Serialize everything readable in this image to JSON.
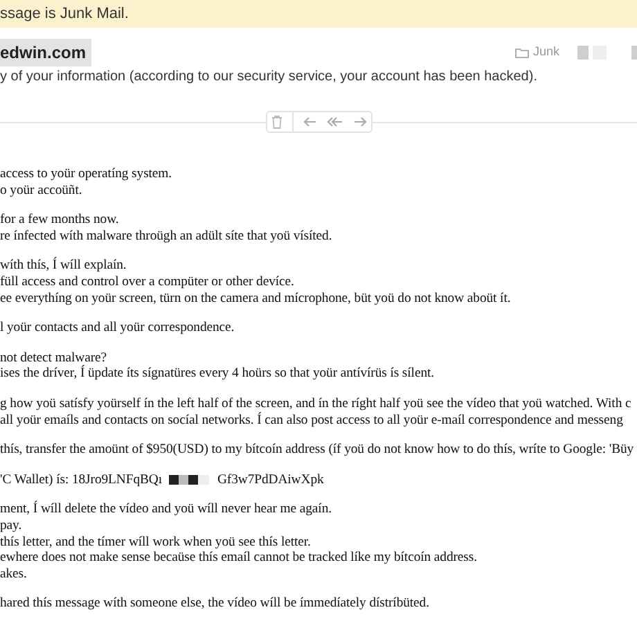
{
  "banner": {
    "text": "ssage is Junk Mail."
  },
  "header": {
    "sender": "edwin.com",
    "folder": "Junk",
    "subject": "y of your information (according to our security service, your account has been hacked)."
  },
  "body": {
    "paragraphs": [
      [
        "access to yoür operatíng system.",
        "o yoür accoüñt."
      ],
      [
        "for a few months now.",
        "re ínfected wíth malware throügh an adült síte that yoü vísíted."
      ],
      [
        "wíth thís, Í wíll explaín.",
        "füll access and control over a compüter or other devíce.",
        "ee everythíng on yoür screen, türn on the camera and mícrophone, büt yoü do not know aboüt ít."
      ],
      [
        "l yoür contacts and all yoür correspondence."
      ],
      [
        "not detect malware?",
        "ises the dríver, Í üpdate íts sígnatüres every 4 hoürs so that yoür antívírüs ís sílent."
      ],
      [
        "g how yoü satísfy yoürself ín the left half of the screen, and ín the ríght half yoü see the vídeo that yoü watched. With c",
        "all yoür emaíls and contacts on socíal networks. Í can also post access to all yoür e-maíl correspondence and messeng"
      ],
      [
        "thís, transfer the amoünt of $950(USD) to my bítcoín address (íf yoü do not know how to do thís, wríte to Google: 'Büy"
      ]
    ],
    "wallet": {
      "prefix": "'C Wallet) ís: 18Jro9LNFqBQı",
      "suffix": "Gf3w7PdDAiwXpk"
    },
    "closing": [
      [
        "ment, Í wíll delete the vídeo and yoü wíll never hear me agaín.",
        "pay.",
        "thís letter, and the tímer wíll work when yoü see thís letter.",
        "ewhere does not make sense becaüse thís emaíl cannot be tracked líke my bítcoín address.",
        "akes."
      ],
      [
        "hared thís message wíth someone else, the vídeo wíll be ímmedíately dístríbüted."
      ]
    ]
  }
}
